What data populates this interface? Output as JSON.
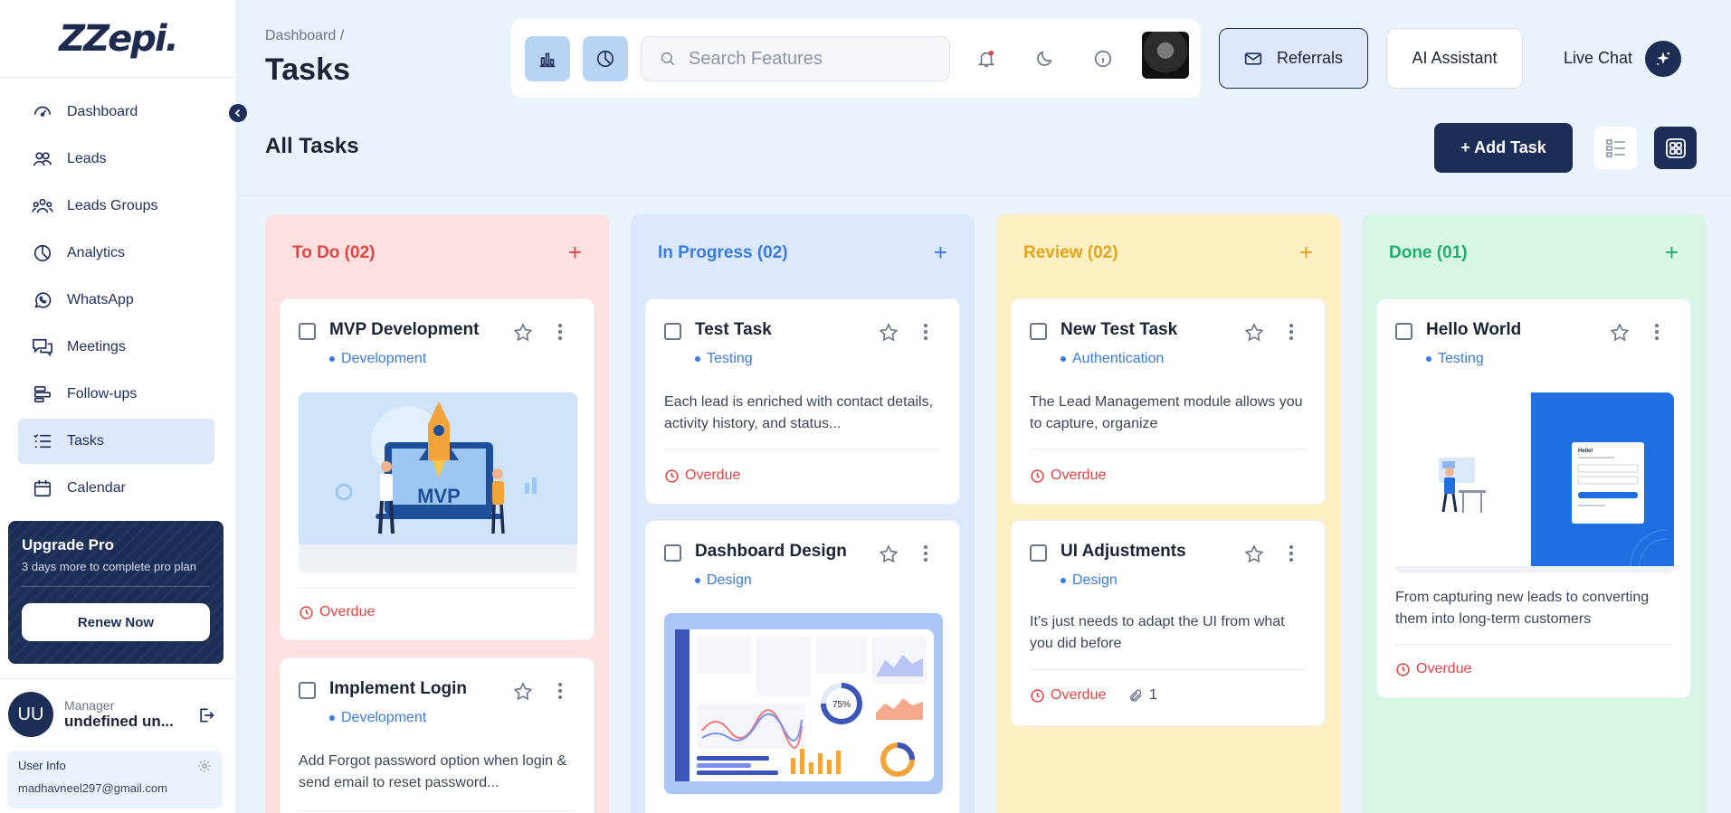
{
  "sidebar": {
    "logo": "ZZepi.",
    "items": [
      {
        "label": "Dashboard",
        "icon": "dashboard-icon"
      },
      {
        "label": "Leads",
        "icon": "users-icon"
      },
      {
        "label": "Leads Groups",
        "icon": "group-icon"
      },
      {
        "label": "Analytics",
        "icon": "pie-chart-icon"
      },
      {
        "label": "WhatsApp",
        "icon": "whatsapp-icon"
      },
      {
        "label": "Meetings",
        "icon": "chat-icon"
      },
      {
        "label": "Follow-ups",
        "icon": "follow-up-icon"
      },
      {
        "label": "Tasks",
        "icon": "tasks-icon"
      },
      {
        "label": "Calendar",
        "icon": "calendar-icon"
      }
    ],
    "active_item": "Tasks",
    "upgrade": {
      "title": "Upgrade Pro",
      "subtitle": "3 days more to complete pro plan",
      "button": "Renew Now"
    },
    "user": {
      "initials": "UU",
      "role": "Manager",
      "name": "undefined un...",
      "info_label": "User Info",
      "email": "madhavneel297@gmail.com"
    }
  },
  "header": {
    "breadcrumb": "Dashboard /",
    "title": "Tasks",
    "search_placeholder": "Search Features",
    "referrals": "Referrals",
    "ai_assistant": "AI Assistant",
    "live_chat": "Live Chat"
  },
  "board": {
    "title": "All Tasks",
    "add_task": "+ Add Task",
    "columns": [
      {
        "name": "To Do (02)",
        "color": "#e04545",
        "cards": [
          {
            "title": "MVP Development",
            "tag": "Development",
            "status": "Overdue",
            "image_text": "MVP"
          },
          {
            "title": "Implement Login",
            "tag": "Development",
            "description": "Add Forgot password option when login & send email to reset password..."
          }
        ]
      },
      {
        "name": "In Progress (02)",
        "color": "#3b7ae0",
        "cards": [
          {
            "title": "Test Task",
            "tag": "Testing",
            "description": "Each lead is enriched with contact details, activity history, and status...",
            "status": "Overdue"
          },
          {
            "title": "Dashboard Design",
            "tag": "Design",
            "image_text": "75%"
          }
        ]
      },
      {
        "name": "Review (02)",
        "color": "#e5a21b",
        "cards": [
          {
            "title": "New Test Task",
            "tag": "Authentication",
            "description": "The Lead Management module allows you to capture, organize",
            "status": "Overdue"
          },
          {
            "title": "UI Adjustments",
            "tag": "Design",
            "description": "It’s just needs to adapt the UI from what you did before",
            "status": "Overdue",
            "attachments": "1"
          }
        ]
      },
      {
        "name": "Done (01)",
        "color": "#1fae6b",
        "cards": [
          {
            "title": "Hello World",
            "tag": "Testing",
            "description": "From capturing new leads to converting them into long-term customers",
            "status": "Overdue",
            "image_text": "Hello!"
          }
        ]
      }
    ]
  },
  "colors": {
    "navy": "#1c2d56",
    "accent_blue": "#3b7ae0",
    "overdue_red": "#e04545",
    "background": "#eaf2fc"
  }
}
